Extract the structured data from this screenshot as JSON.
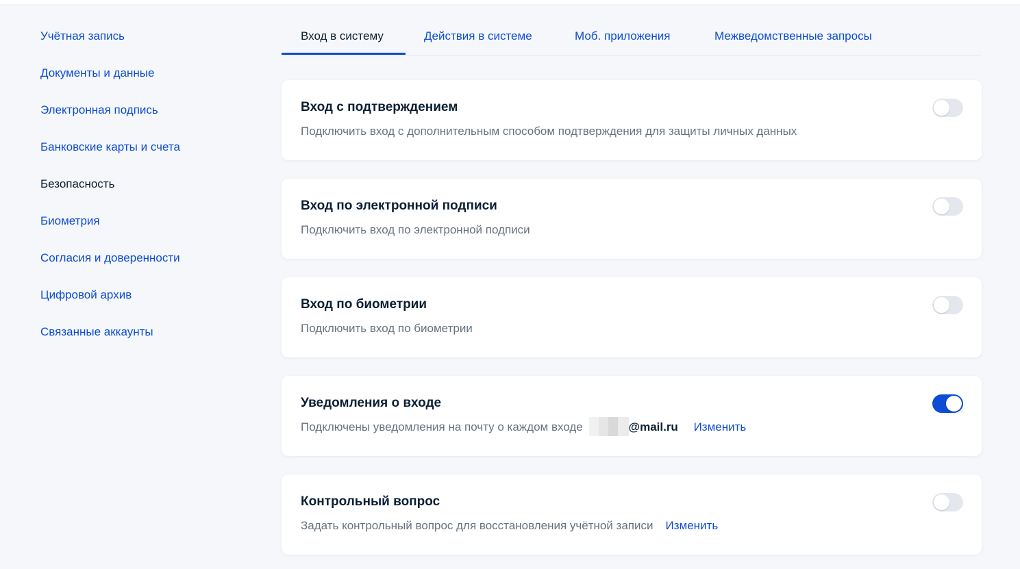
{
  "sidebar": {
    "items": [
      {
        "label": "Учётная запись"
      },
      {
        "label": "Документы и данные"
      },
      {
        "label": "Электронная подпись"
      },
      {
        "label": "Банковские карты и счета"
      },
      {
        "label": "Безопасность",
        "active": true
      },
      {
        "label": "Биометрия"
      },
      {
        "label": "Согласия и доверенности"
      },
      {
        "label": "Цифровой архив"
      },
      {
        "label": "Связанные аккаунты"
      }
    ]
  },
  "tabs": [
    {
      "label": "Вход в систему",
      "active": true
    },
    {
      "label": "Действия в системе"
    },
    {
      "label": "Моб. приложения"
    },
    {
      "label": "Межведомственные запросы"
    }
  ],
  "settings": [
    {
      "title": "Вход с подтверждением",
      "description": "Подключить вход с дополнительным способом подтверждения для защиты личных данных",
      "enabled": false
    },
    {
      "title": "Вход по электронной подписи",
      "description": "Подключить вход по электронной подписи",
      "enabled": false
    },
    {
      "title": "Вход по биометрии",
      "description": "Подключить вход по биометрии",
      "enabled": false
    },
    {
      "title": "Уведомления о входе",
      "description": "Подключены уведомления на почту о каждом входе",
      "email_domain": "@mail.ru",
      "action": "Изменить",
      "enabled": true
    },
    {
      "title": "Контрольный вопрос",
      "description": "Задать контрольный вопрос для восстановления учётной записи",
      "action": "Изменить",
      "enabled": false
    }
  ],
  "colors": {
    "accent": "#0d4cd3",
    "text": "#0b1f33",
    "muted": "#66727f",
    "background": "#f5f7fa",
    "toggle_off": "#e4e8ee"
  }
}
